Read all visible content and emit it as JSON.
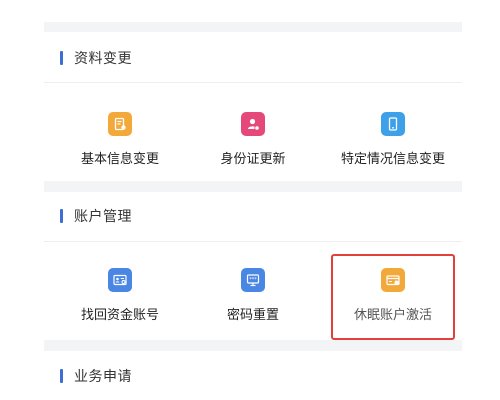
{
  "sections": [
    {
      "title": "资料变更",
      "items": [
        {
          "label": "基本信息变更",
          "icon": "document-edit-icon",
          "color": "#f3a93a"
        },
        {
          "label": "身份证更新",
          "icon": "id-user-icon",
          "color": "#e4497a"
        },
        {
          "label": "特定情况信息变更",
          "icon": "phone-icon",
          "color": "#3ea0e8"
        }
      ]
    },
    {
      "title": "账户管理",
      "items": [
        {
          "label": "找回资金账号",
          "icon": "id-card-search-icon",
          "color": "#4a86e4"
        },
        {
          "label": "密码重置",
          "icon": "password-reset-icon",
          "color": "#4a86e4"
        },
        {
          "label": "休眠账户激活",
          "icon": "card-activate-icon",
          "color": "#f3a93a",
          "highlighted": true,
          "highlight_color": "#e0413b"
        }
      ]
    },
    {
      "title": "业务申请"
    }
  ],
  "accent_color": "#3d6fd2"
}
